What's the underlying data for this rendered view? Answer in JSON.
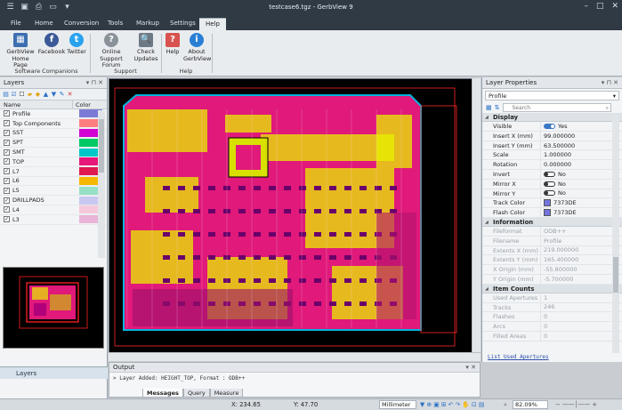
{
  "window": {
    "title": "testcase6.tgz - GerbView 9"
  },
  "quick_access": [
    "menu-icon",
    "save-icon",
    "print-icon",
    "folder-icon",
    "dropdown-icon"
  ],
  "tabs": [
    {
      "label": "File"
    },
    {
      "label": "Home"
    },
    {
      "label": "Conversion"
    },
    {
      "label": "Tools"
    },
    {
      "label": "Markup"
    },
    {
      "label": "Settings"
    },
    {
      "label": "Help",
      "active": true
    }
  ],
  "ribbon": {
    "groups": [
      {
        "label": "Software Companions",
        "buttons": [
          {
            "line1": "GerbView",
            "line2": "Home Page",
            "icon": "gerbview-home-icon"
          },
          {
            "line1": "Facebook",
            "line2": "",
            "icon": "facebook-icon"
          },
          {
            "line1": "Twitter",
            "line2": "",
            "icon": "twitter-icon"
          }
        ]
      },
      {
        "label": "Support",
        "buttons": [
          {
            "line1": "Online",
            "line2": "Support Forum",
            "icon": "support-forum-icon"
          },
          {
            "line1": "Check",
            "line2": "Updates",
            "icon": "check-updates-icon"
          }
        ]
      },
      {
        "label": "Help",
        "buttons": [
          {
            "line1": "Help",
            "line2": "",
            "icon": "help-icon"
          },
          {
            "line1": "About",
            "line2": "GerbView",
            "icon": "about-icon"
          }
        ]
      }
    ]
  },
  "layers_panel": {
    "title": "Layers",
    "col_name": "Name",
    "col_color": "Color",
    "rows": [
      {
        "name": "Profile",
        "color": "#7b7bd6"
      },
      {
        "name": "Top Components",
        "color": "#ff7f7f"
      },
      {
        "name": "SST",
        "color": "#d200d2"
      },
      {
        "name": "SPT",
        "color": "#00c864"
      },
      {
        "name": "SMT",
        "color": "#00c8c8"
      },
      {
        "name": "TOP",
        "color": "#e8187a"
      },
      {
        "name": "L7",
        "color": "#e01a4f"
      },
      {
        "name": "L6",
        "color": "#f5b800"
      },
      {
        "name": "L5",
        "color": "#96e0c8"
      },
      {
        "name": "DRILLPADS",
        "color": "#c8c8f0"
      },
      {
        "name": "L4",
        "color": "#f5c8dc"
      },
      {
        "name": "L3",
        "color": "#e8b4d8"
      }
    ],
    "bottom_tab": "Layers"
  },
  "output_panel": {
    "title": "Output",
    "line": "> Layer Added: HEIGHT_TOP, Format : ODB++",
    "tabs": [
      "Messages",
      "Query",
      "Measure"
    ]
  },
  "properties_panel": {
    "title": "Layer Properties",
    "selected": "Profile",
    "search_placeholder": "Search",
    "sections": [
      {
        "name": "Display",
        "rows": [
          {
            "key": "Visible",
            "value": "Yes",
            "toggle": "on"
          },
          {
            "key": "Insert X (mm)",
            "value": "99.000000"
          },
          {
            "key": "Insert Y (mm)",
            "value": "63.500000"
          },
          {
            "key": "Scale",
            "value": "1.000000"
          },
          {
            "key": "Rotation",
            "value": "0.000000"
          },
          {
            "key": "Invert",
            "value": "No",
            "toggle": "off"
          },
          {
            "key": "Mirror X",
            "value": "No",
            "toggle": "off"
          },
          {
            "key": "Mirror Y",
            "value": "No",
            "toggle": "off"
          },
          {
            "key": "Track Color",
            "value": "7373DE",
            "swatch": "#7373de"
          },
          {
            "key": "Flash Color",
            "value": "7373DE",
            "swatch": "#7373de"
          }
        ]
      },
      {
        "name": "Information",
        "rows": [
          {
            "key": "Fileformat",
            "value": "ODB++",
            "dim": true
          },
          {
            "key": "Filename",
            "value": "Profile",
            "dim": true
          },
          {
            "key": "Extents X (mm)",
            "value": "219.000000",
            "dim": true
          },
          {
            "key": "Extents Y (mm)",
            "value": "165.400000",
            "dim": true
          },
          {
            "key": "X Origin (mm)",
            "value": "-55.800000",
            "dim": true
          },
          {
            "key": "Y Origin (mm)",
            "value": "-5.700000",
            "dim": true
          }
        ]
      },
      {
        "name": "Item Counts",
        "rows": [
          {
            "key": "Used Apertures",
            "value": "1",
            "dim": true
          },
          {
            "key": "Tracks",
            "value": "246",
            "dim": true
          },
          {
            "key": "Flashes",
            "value": "0",
            "dim": true
          },
          {
            "key": "Arcs",
            "value": "0",
            "dim": true
          },
          {
            "key": "Filled Areas",
            "value": "0",
            "dim": true
          }
        ]
      }
    ],
    "link": "List Used Apertures"
  },
  "statusbar": {
    "x": "X: 234.65",
    "y": "Y: 47.70",
    "unit": "Millimeter",
    "zoom": "82.09%"
  },
  "canvas": {
    "background": "#000000",
    "board_color": "#e0197a",
    "copper_color": "#e8f000",
    "outline_color": "#00b4dc"
  }
}
